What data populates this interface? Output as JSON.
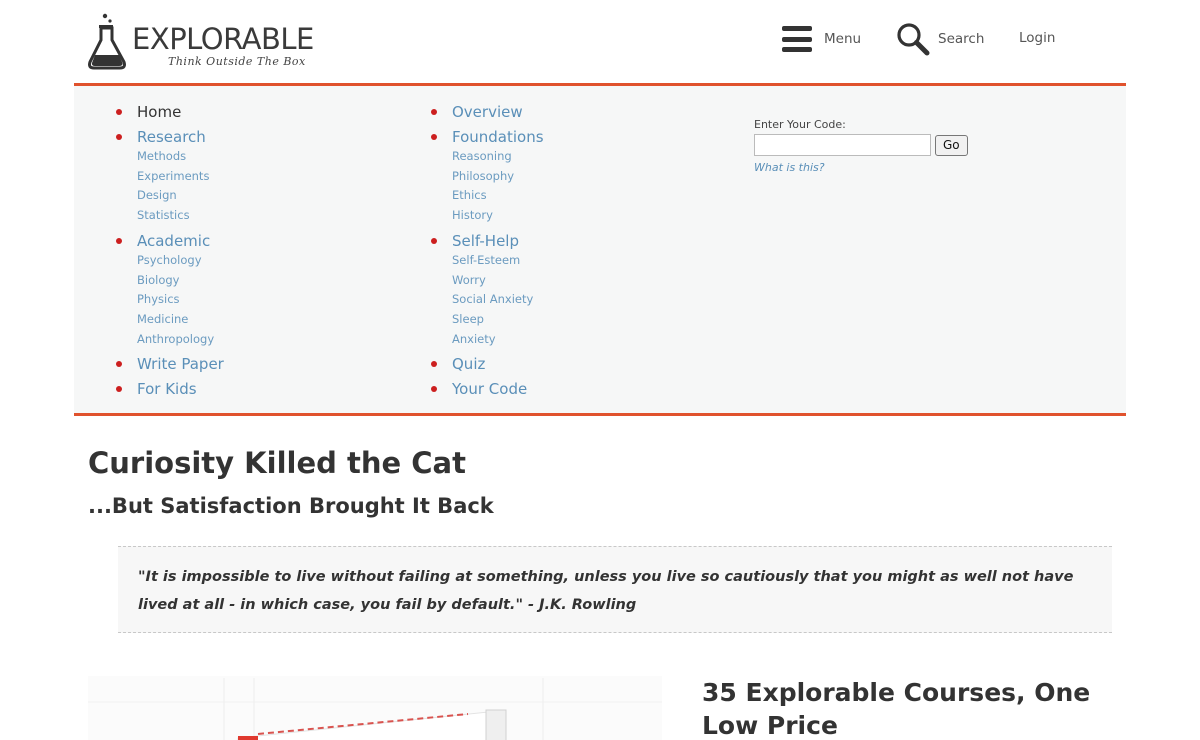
{
  "header": {
    "logo_word": "EXPLORABLE",
    "logo_tagline": "Think Outside The Box",
    "menu_label": "Menu",
    "search_label": "Search",
    "login_label": "Login"
  },
  "nav": {
    "accent_color": "#e0522d",
    "bullet_color": "#cc1f1f",
    "link_color": "#5a8fb8",
    "col1": [
      {
        "label": "Home",
        "active": true,
        "subs": []
      },
      {
        "label": "Research",
        "subs": [
          "Methods",
          "Experiments",
          "Design",
          "Statistics"
        ]
      },
      {
        "label": "Academic",
        "subs": [
          "Psychology",
          "Biology",
          "Physics",
          "Medicine",
          "Anthropology"
        ]
      },
      {
        "label": "Write Paper",
        "subs": []
      },
      {
        "label": "For Kids",
        "subs": []
      }
    ],
    "col2": [
      {
        "label": "Overview",
        "subs": []
      },
      {
        "label": "Foundations",
        "subs": [
          "Reasoning",
          "Philosophy",
          "Ethics",
          "History"
        ]
      },
      {
        "label": "Self-Help",
        "subs": [
          "Self-Esteem",
          "Worry",
          "Social Anxiety",
          "Sleep",
          "Anxiety"
        ]
      },
      {
        "label": "Quiz",
        "subs": []
      },
      {
        "label": "Your Code",
        "subs": []
      }
    ],
    "code_form": {
      "label": "Enter Your Code:",
      "input_value": "",
      "go_label": "Go",
      "help_link": "What is this?"
    }
  },
  "article": {
    "title": "Curiosity Killed the Cat",
    "subtitle": "...But Satisfaction Brought It Back",
    "quote": "\"It is impossible to live without failing at something, unless you live so cautiously that you might as well not have lived at all - in which case, you fail by default.\" - J.K. Rowling",
    "promo_title": "35 Explorable Courses, One Low Price"
  }
}
